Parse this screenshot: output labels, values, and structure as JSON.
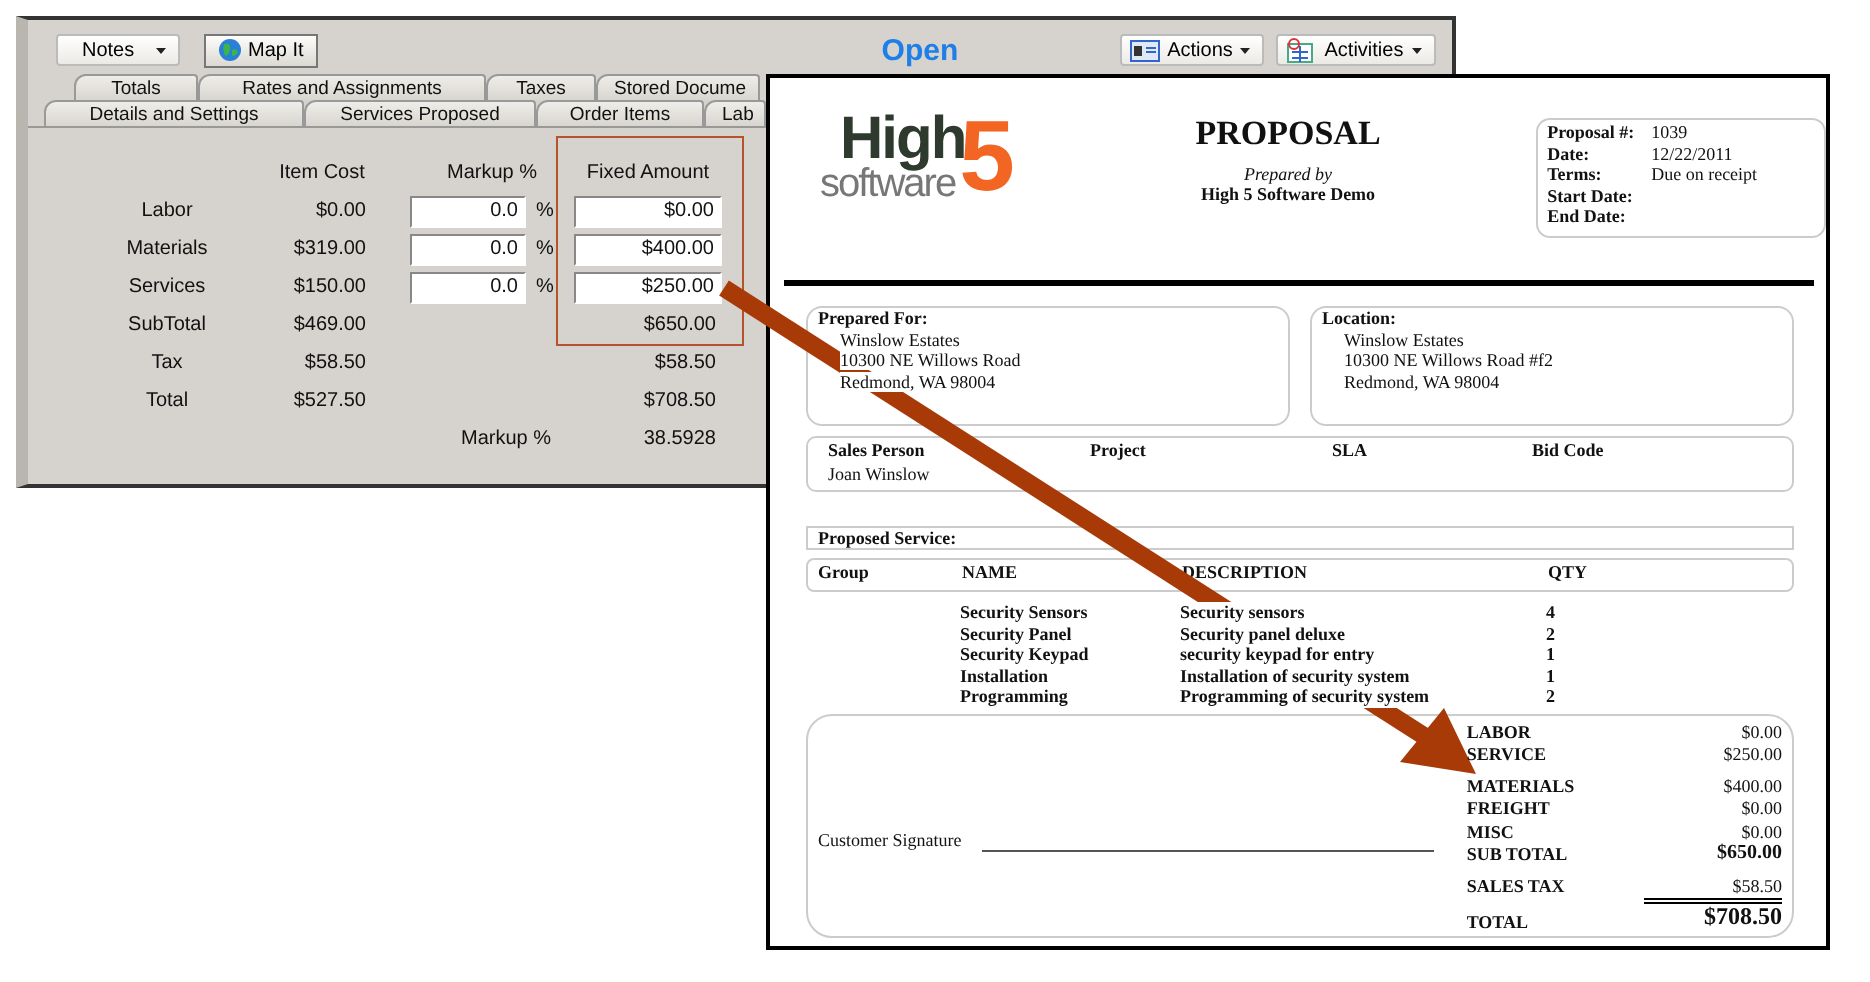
{
  "app_window": {
    "toolbar": {
      "notes_button": "Notes",
      "map_button": "Map It",
      "status": "Open",
      "actions_button": "Actions",
      "activities_button": "Activities"
    },
    "tabs_row_1": [
      "Totals",
      "Rates and Assignments",
      "Taxes",
      "Stored Docume"
    ],
    "tabs_row_2": [
      "Details and Settings",
      "Services Proposed",
      "Order Items",
      "Lab"
    ],
    "totals": {
      "columns": [
        "Item Cost",
        "Markup %",
        "Fixed Amount"
      ],
      "rows": [
        {
          "kind": "input",
          "label": "Labor",
          "item_cost": "$0.00",
          "markup": "0.0",
          "percent": "%",
          "fixed": "$0.00"
        },
        {
          "kind": "input",
          "label": "Materials",
          "item_cost": "$319.00",
          "markup": "0.0",
          "percent": "%",
          "fixed": "$400.00"
        },
        {
          "kind": "input",
          "label": "Services",
          "item_cost": "$150.00",
          "markup": "0.0",
          "percent": "%",
          "fixed": "$250.00"
        },
        {
          "kind": "text",
          "label": "SubTotal",
          "item_cost": "$469.00",
          "fixed": "$650.00"
        },
        {
          "kind": "text",
          "label": "Tax",
          "item_cost": "$58.50",
          "fixed": "$58.50"
        },
        {
          "kind": "text",
          "label": "Total",
          "item_cost": "$527.50",
          "fixed": "$708.50"
        }
      ],
      "markup_label": "Markup %",
      "markup_value": "38.5928"
    }
  },
  "proposal": {
    "logo": {
      "word": "High",
      "sub": "software",
      "mark": "5"
    },
    "title": "PROPOSAL",
    "prepared_by": "Prepared by",
    "company": "High 5 Software Demo",
    "info": [
      {
        "label": "Proposal #:",
        "value": "1039"
      },
      {
        "label": "Date:",
        "value": "12/22/2011"
      },
      {
        "label": "Terms:",
        "value": "Due on receipt"
      },
      {
        "label": "Start Date:"
      },
      {
        "label": "End Date:"
      }
    ],
    "prepared_for": {
      "heading": "Prepared For:",
      "lines": [
        "Winslow Estates",
        "10300 NE Willows Road",
        "Redmond, WA 98004"
      ]
    },
    "location": {
      "heading": "Location:",
      "lines": [
        "Winslow Estates",
        "10300 NE Willows Road #f2",
        "Redmond, WA 98004"
      ]
    },
    "people": [
      {
        "heading": "Sales Person",
        "value": "Joan Winslow"
      },
      {
        "heading": "Project"
      },
      {
        "heading": "SLA"
      },
      {
        "heading": "Bid Code"
      }
    ],
    "service_heading": "Proposed Service:",
    "columns": [
      "Group",
      "NAME",
      "DESCRIPTION",
      "QTY"
    ],
    "items": [
      {
        "name": "Security Sensors",
        "description": "Security sensors",
        "qty": "4"
      },
      {
        "name": "Security Panel",
        "description": "Security panel deluxe",
        "qty": "2"
      },
      {
        "name": "Security Keypad",
        "description": "security keypad for entry",
        "qty": "1"
      },
      {
        "name": "Installation",
        "description": "Installation of security system",
        "qty": "1"
      },
      {
        "name": "Programming",
        "description": "Programming of security system",
        "qty": "2"
      }
    ],
    "signature_label": "Customer Signature",
    "summary": [
      {
        "kind": "line",
        "label": "LABOR",
        "value": "$0.00"
      },
      {
        "kind": "line",
        "label": "SERVICE",
        "value": "$250.00"
      },
      {
        "kind": "gap",
        "label": "MATERIALS",
        "value": "$400.00"
      },
      {
        "kind": "line",
        "label": "FREIGHT",
        "value": "$0.00"
      },
      {
        "kind": "line",
        "label": "MISC",
        "value": "$0.00"
      },
      {
        "kind": "subtotal",
        "label": "SUB TOTAL",
        "value": "$650.00"
      },
      {
        "kind": "tax",
        "label": "SALES TAX",
        "value": "$58.50"
      },
      {
        "kind": "total",
        "label": "TOTAL",
        "value": "$708.50"
      }
    ]
  }
}
